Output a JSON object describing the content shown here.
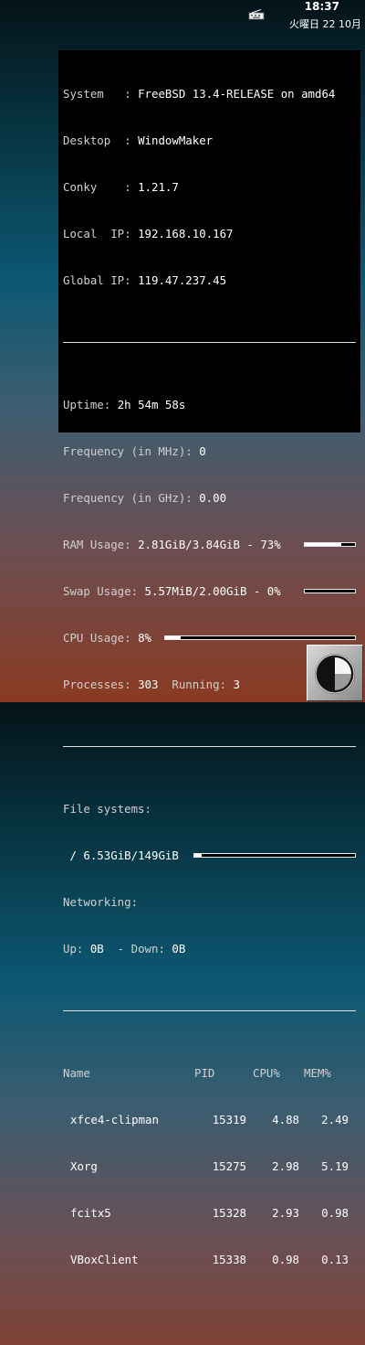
{
  "topbar": {
    "time": "18:37",
    "date": "火曜日 22 10月",
    "tray_icon": "keyboard-icon"
  },
  "conky": {
    "system_label": "System   : ",
    "system_value": "FreeBSD 13.4-RELEASE on amd64",
    "desktop_label": "Desktop  : ",
    "desktop_value": "WindowMaker",
    "conky_label": "Conky    : ",
    "conky_value": "1.21.7",
    "local_ip_label": "Local  IP: ",
    "local_ip_value": "192.168.10.167",
    "global_ip_label": "Global IP: ",
    "global_ip_value": "119.47.237.45",
    "uptime_label": "Uptime: ",
    "uptime_value": "2h 54m 58s",
    "freq_mhz_label": "Frequency (in MHz): ",
    "freq_mhz_value": "0",
    "freq_ghz_label": "Frequency (in GHz): ",
    "freq_ghz_value": "0.00",
    "ram_label": "RAM Usage: ",
    "ram_value": "2.81GiB/3.84GiB - 73%",
    "ram_fraction": 0.73,
    "swap_label": "Swap Usage: ",
    "swap_value": "5.57MiB/2.00GiB - 0%",
    "swap_fraction": 0.0,
    "cpu_label": "CPU Usage: ",
    "cpu_value": "8%",
    "cpu_fraction": 0.08,
    "processes_label": "Processes: ",
    "processes_value": "303",
    "running_label": "  Running: ",
    "running_value": "3",
    "fs_label": "File systems:",
    "fs_root": " / ",
    "fs_root_value": "6.53GiB/149GiB",
    "fs_fraction": 0.044,
    "net_label": "Networking:",
    "up_label": "Up: ",
    "up_value": "0B",
    "down_label": "  - Down: ",
    "down_value": "0B",
    "process_table": {
      "headers": {
        "name": "Name",
        "pid": "PID",
        "cpu": "CPU%",
        "mem": "MEM%"
      },
      "rows": [
        {
          "name": "xfce4-clipman",
          "pid": "15319",
          "cpu": "4.88",
          "mem": "2.49"
        },
        {
          "name": "Xorg",
          "pid": "15275",
          "cpu": "2.98",
          "mem": "5.19"
        },
        {
          "name": "fcitx5",
          "pid": "15328",
          "cpu": "2.93",
          "mem": "0.98"
        },
        {
          "name": "VBoxClient",
          "pid": "15338",
          "cpu": "0.98",
          "mem": "0.13"
        }
      ]
    }
  },
  "dock": {
    "icon": "windowmaker-clock-icon"
  }
}
